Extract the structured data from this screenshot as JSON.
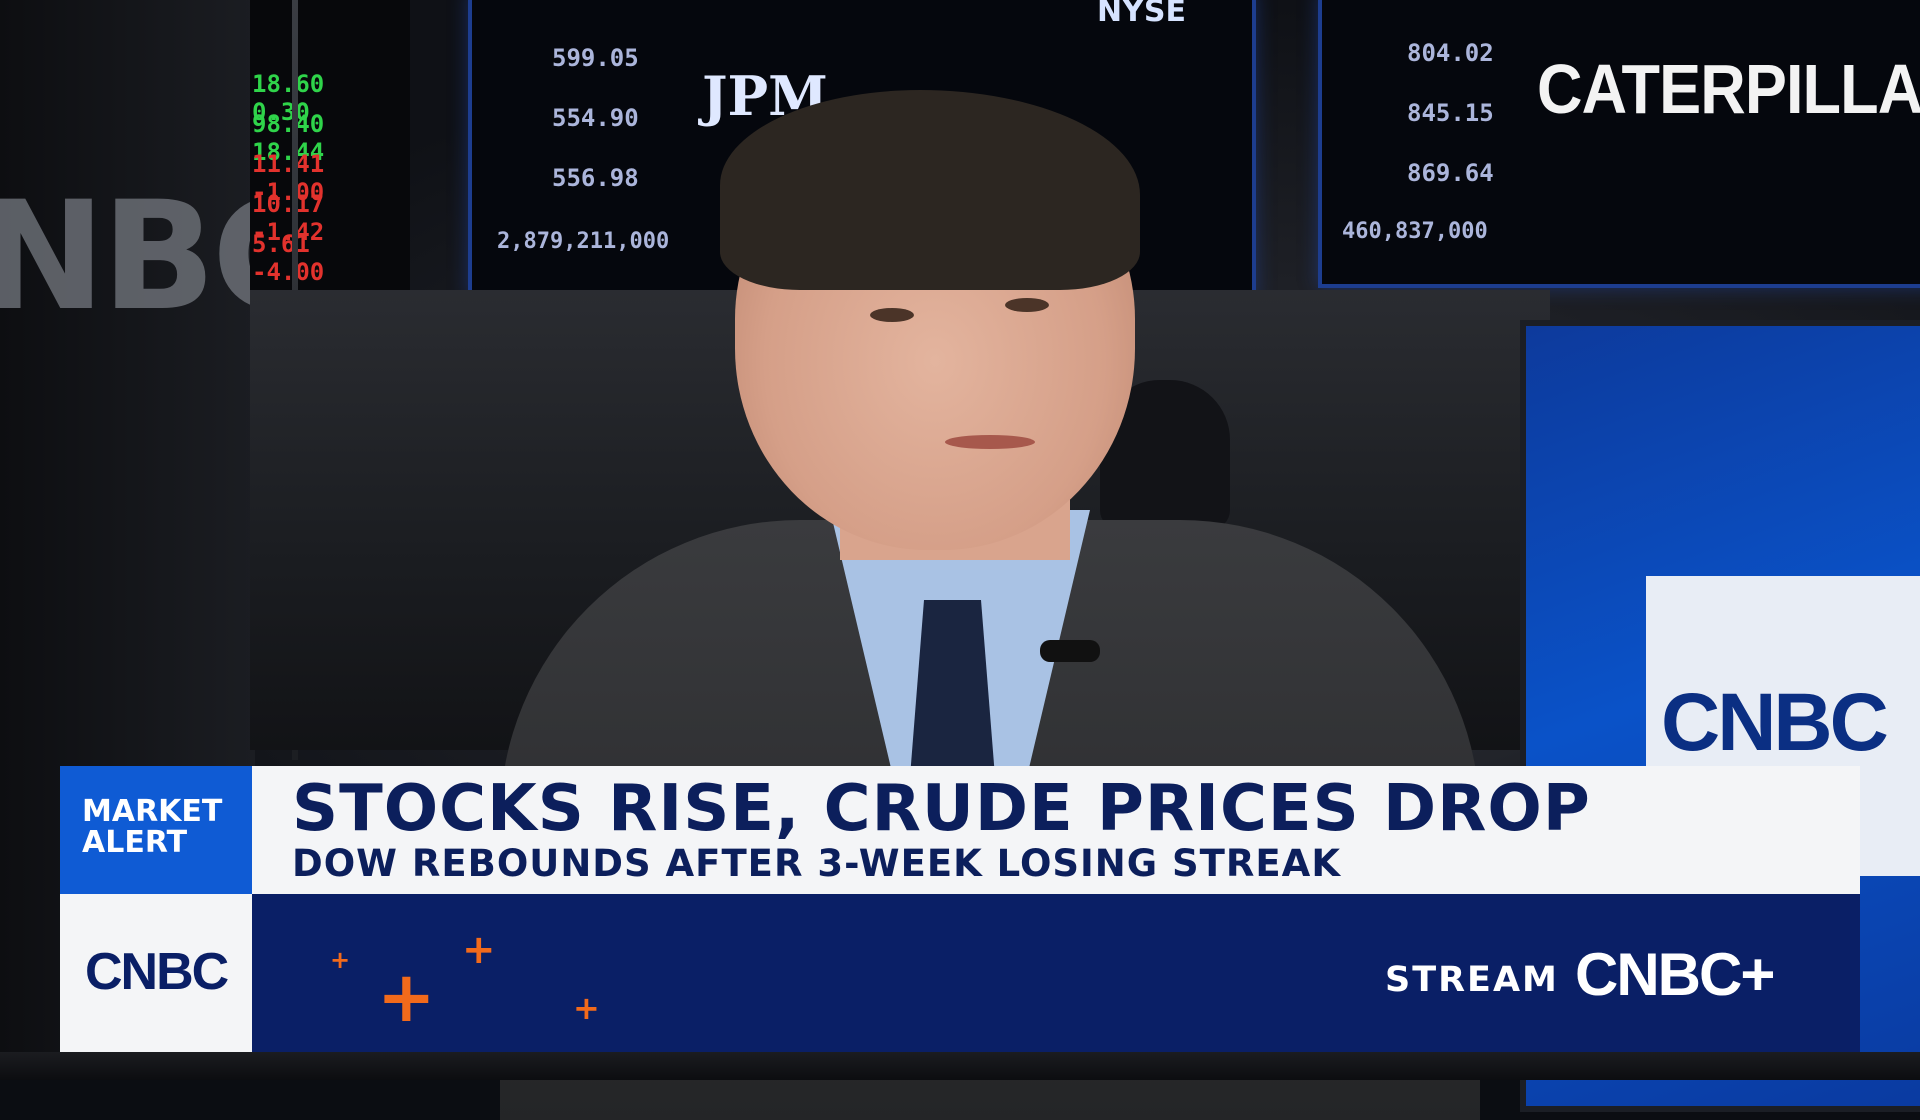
{
  "studio": {
    "wall_logo": "NBC",
    "side_screen_logo": "CNBC",
    "tickers": [
      {
        "a": "18.60",
        "b": "0.30",
        "color": "#2fd44a"
      },
      {
        "a": "98.40",
        "b": "18.44",
        "color": "#2fd44a"
      },
      {
        "a": "11.41",
        "b": "-1.00",
        "color": "#e2322d"
      },
      {
        "a": "10.17",
        "b": "-1.42",
        "color": "#e2322d"
      },
      {
        "a": "5.61",
        "b": "-4.00",
        "color": "#e2322d"
      }
    ],
    "monitor_center": {
      "brand": "JPM",
      "exchange": "NYSE",
      "numbers": [
        "599.05",
        "554.90",
        "556.98",
        "2,879,211,000"
      ]
    },
    "monitor_right": {
      "brand": "CATERPILLAR",
      "numbers": [
        "804.02",
        "845.15",
        "869.64",
        "460,837,000"
      ]
    }
  },
  "lower_third": {
    "tag": "MARKET ALERT",
    "headline": "STOCKS RISE, CRUDE PRICES DROP",
    "subhead": "DOW REBOUNDS AFTER 3-WEEK LOSING STREAK",
    "network_logo": "CNBC",
    "stream_label": "STREAM",
    "stream_logo": "CNBC+",
    "accent_color": "#f26a1b",
    "brand_blue": "#0a1f66"
  }
}
